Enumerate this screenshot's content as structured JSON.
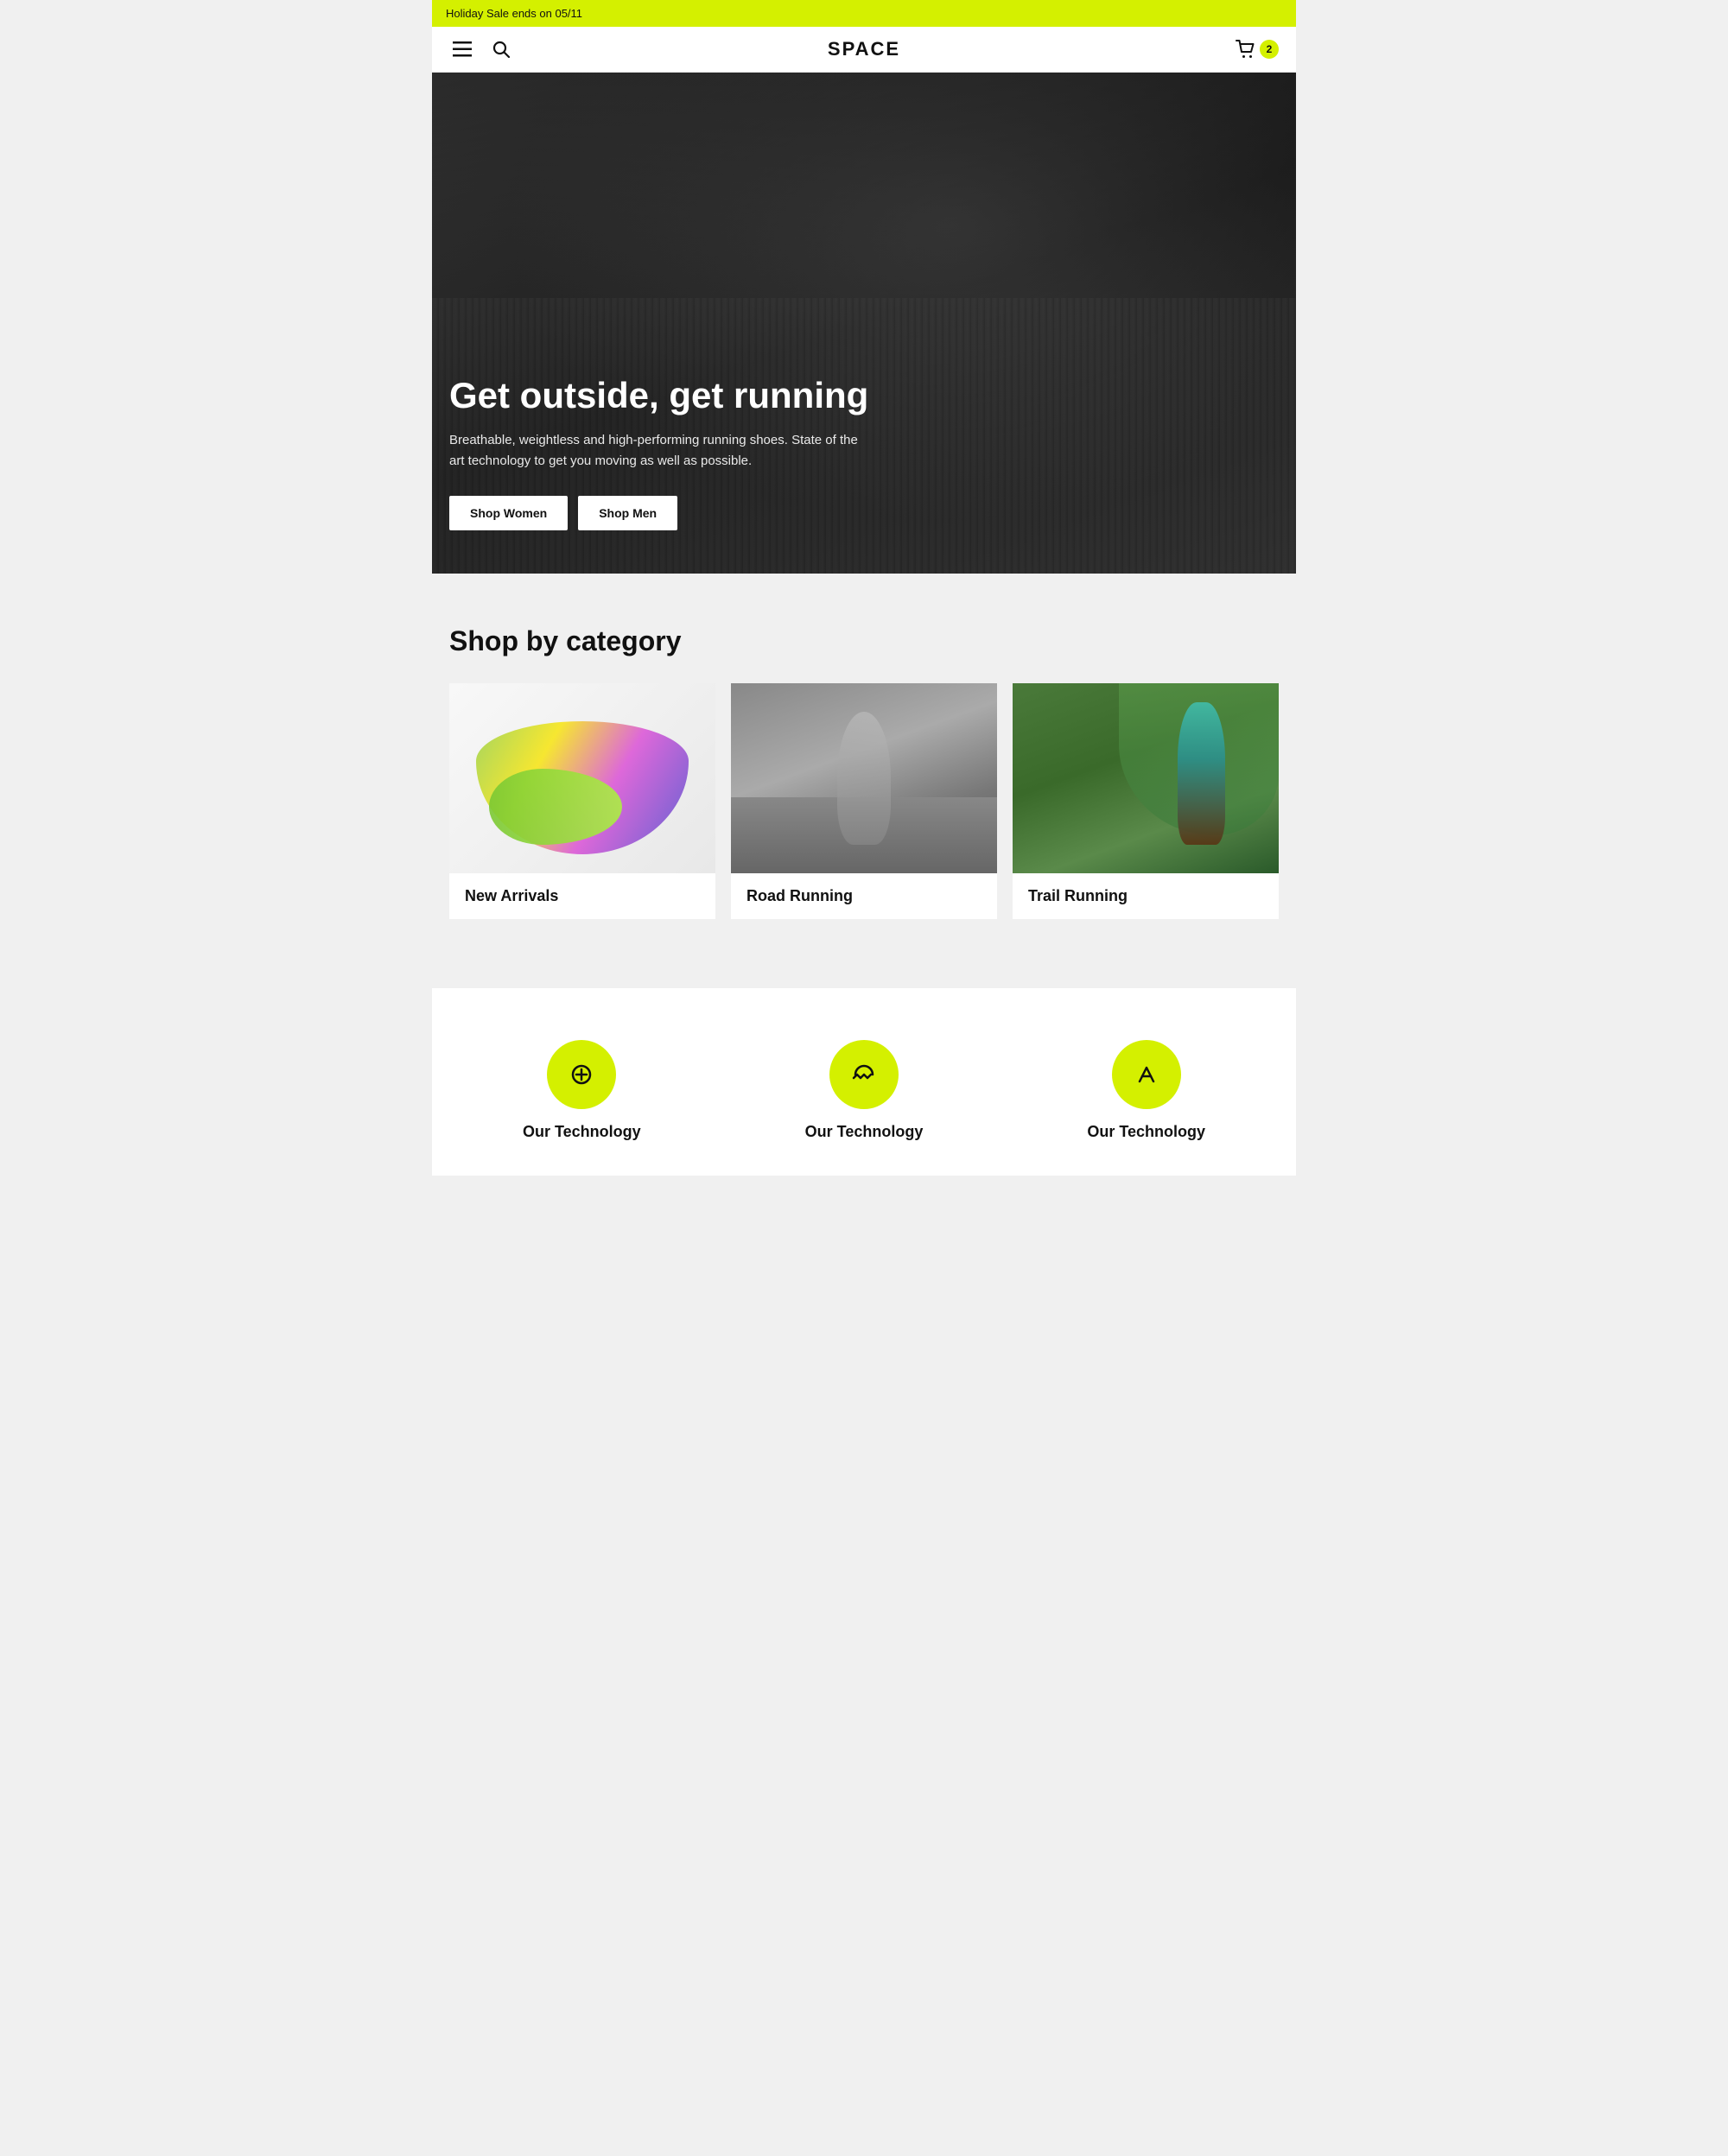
{
  "announcement": {
    "text": "Holiday Sale ends on 05/11"
  },
  "navbar": {
    "brand": "SPACE",
    "cart_count": "2"
  },
  "hero": {
    "title": "Get outside, get running",
    "subtitle": "Breathable, weightless and high-performing running shoes. State of the art technology to get you moving as well as possible.",
    "shop_women_label": "Shop Women",
    "shop_men_label": "Shop Men"
  },
  "category_section": {
    "title": "Shop by category",
    "categories": [
      {
        "label": "New Arrivals",
        "img_type": "new-arrivals"
      },
      {
        "label": "Road Running",
        "img_type": "road-running"
      },
      {
        "label": "Trail Running",
        "img_type": "trail-running"
      }
    ]
  },
  "tech_section": {
    "title": "Our Technology"
  }
}
